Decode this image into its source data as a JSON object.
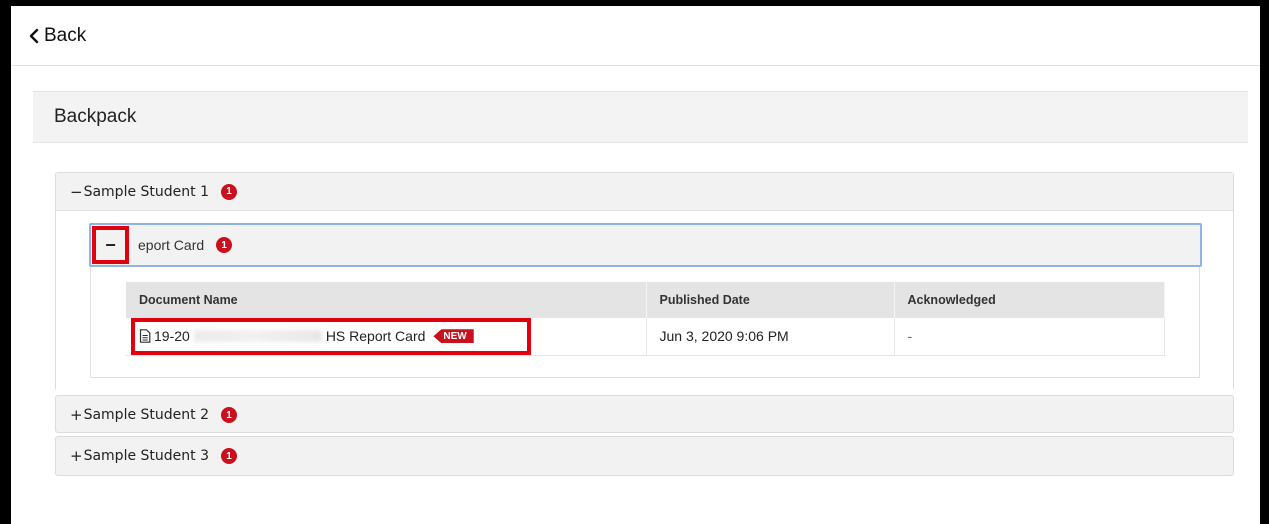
{
  "header": {
    "back_label": "Back"
  },
  "section": {
    "title": "Backpack"
  },
  "students": [
    {
      "name": "Sample Student 1",
      "toggle": "−",
      "badge": "1"
    },
    {
      "name": "Sample Student 2",
      "toggle": "+",
      "badge": "1"
    },
    {
      "name": "Sample Student 3",
      "toggle": "+",
      "badge": "1"
    }
  ],
  "report_card": {
    "title": "Report Card",
    "visible_title": "eport Card",
    "toggle": "−",
    "badge": "1"
  },
  "table": {
    "columns": [
      "Document Name",
      "Published Date",
      "Acknowledged"
    ],
    "rows": [
      {
        "doc_prefix": "19-20",
        "doc_suffix": "HS Report Card",
        "tag": "NEW",
        "published": "Jun 3, 2020 9:06 PM",
        "acknowledged": "-"
      }
    ]
  },
  "colors": {
    "badge": "#c8101e",
    "highlight": "#e0000e",
    "focus_border": "#8fb3e8",
    "panel_bg": "#f2f2f2"
  },
  "icons": [
    "chevron-left-icon",
    "document-icon"
  ]
}
